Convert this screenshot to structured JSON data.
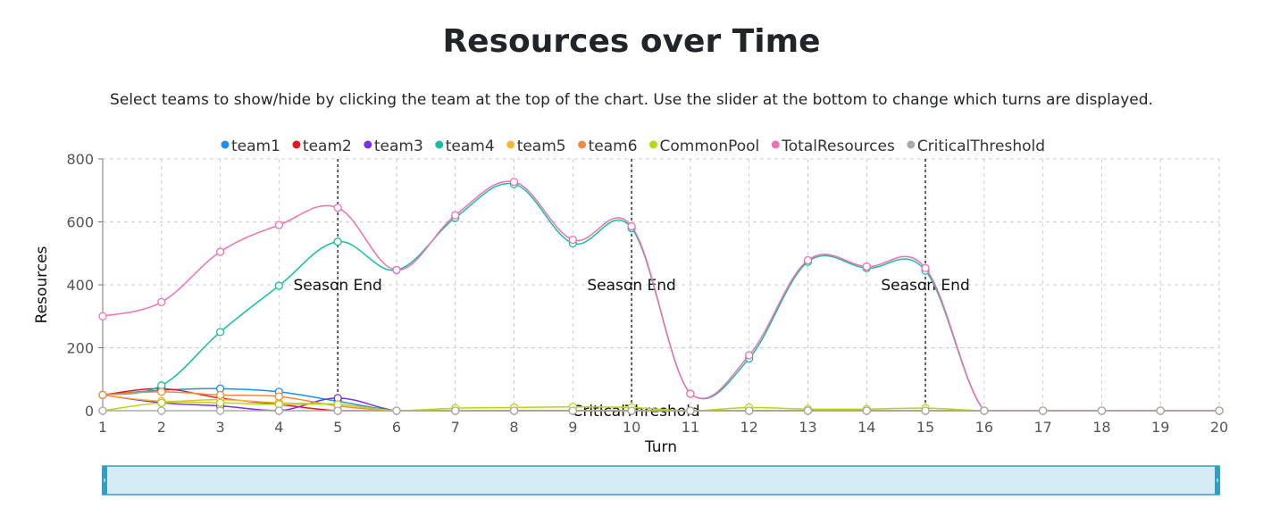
{
  "page": {
    "title": "Resources over Time",
    "subtitle": "Select teams to show/hide by clicking the team at the top of the chart. Use the slider at the bottom to change which turns are displayed."
  },
  "chart_data": {
    "type": "line",
    "xlabel": "Turn",
    "ylabel": "Resources",
    "xlim": [
      1,
      20
    ],
    "ylim": [
      0,
      800
    ],
    "x": [
      1,
      2,
      3,
      4,
      5,
      6,
      7,
      8,
      9,
      10,
      11,
      12,
      13,
      14,
      15,
      16,
      17,
      18,
      19,
      20
    ],
    "xticks": [
      1,
      2,
      3,
      4,
      5,
      6,
      7,
      8,
      9,
      10,
      11,
      12,
      13,
      14,
      15,
      16,
      17,
      18,
      19,
      20
    ],
    "yticks": [
      0,
      200,
      400,
      600,
      800
    ],
    "grid": true,
    "legend_position": "top",
    "series": [
      {
        "name": "team1",
        "color": "#1f8ef1",
        "values": [
          50,
          65,
          70,
          60,
          30,
          0,
          0,
          0,
          0,
          0,
          0,
          0,
          0,
          0,
          0,
          0,
          0,
          0,
          0,
          0
        ]
      },
      {
        "name": "team2",
        "color": "#e31a1c",
        "values": [
          50,
          70,
          40,
          20,
          0,
          0,
          0,
          0,
          0,
          0,
          0,
          0,
          0,
          0,
          0,
          0,
          0,
          0,
          0,
          0
        ]
      },
      {
        "name": "team3",
        "color": "#7b2ee6",
        "values": [
          50,
          25,
          15,
          0,
          40,
          0,
          0,
          0,
          0,
          0,
          0,
          0,
          0,
          0,
          0,
          0,
          0,
          0,
          0,
          0
        ]
      },
      {
        "name": "team4",
        "color": "#17bfa0",
        "values": [
          50,
          80,
          250,
          397,
          537,
          447,
          613,
          720,
          532,
          580,
          54,
          166,
          473,
          453,
          445,
          0,
          0,
          0,
          0,
          0
        ]
      },
      {
        "name": "team5",
        "color": "#f5b731",
        "values": [
          50,
          30,
          35,
          25,
          20,
          0,
          0,
          0,
          0,
          0,
          0,
          0,
          0,
          0,
          0,
          0,
          0,
          0,
          0,
          0
        ]
      },
      {
        "name": "team6",
        "color": "#f08a3c",
        "values": [
          50,
          60,
          50,
          45,
          15,
          0,
          0,
          0,
          0,
          0,
          0,
          0,
          0,
          0,
          0,
          0,
          0,
          0,
          0,
          0
        ]
      },
      {
        "name": "CommonPool",
        "color": "#b5d80f",
        "values": [
          0,
          25,
          25,
          20,
          20,
          0,
          8,
          10,
          12,
          10,
          0,
          10,
          5,
          5,
          8,
          0,
          0,
          0,
          0,
          0
        ]
      },
      {
        "name": "TotalResources",
        "color": "#f06fb3",
        "values": [
          300,
          345,
          505,
          590,
          645,
          447,
          621,
          727,
          543,
          586,
          54,
          176,
          478,
          458,
          453,
          0,
          0,
          0,
          0,
          0
        ]
      },
      {
        "name": "CriticalThreshold",
        "color": "#aaaaaa",
        "values": [
          0,
          0,
          0,
          0,
          0,
          0,
          0,
          0,
          0,
          0,
          0,
          0,
          0,
          0,
          0,
          0,
          0,
          0,
          0,
          0
        ]
      }
    ],
    "annotations": [
      {
        "type": "vline",
        "x": 5,
        "label": "Season End",
        "label_y": 400
      },
      {
        "type": "vline",
        "x": 10,
        "label": "Season End",
        "label_y": 400
      },
      {
        "type": "vline",
        "x": 15,
        "label": "Season End",
        "label_y": 400
      },
      {
        "type": "text",
        "x": 10,
        "y": 0,
        "label": "CriticalThreshold"
      }
    ],
    "slider": {
      "range": [
        1,
        20
      ]
    }
  }
}
